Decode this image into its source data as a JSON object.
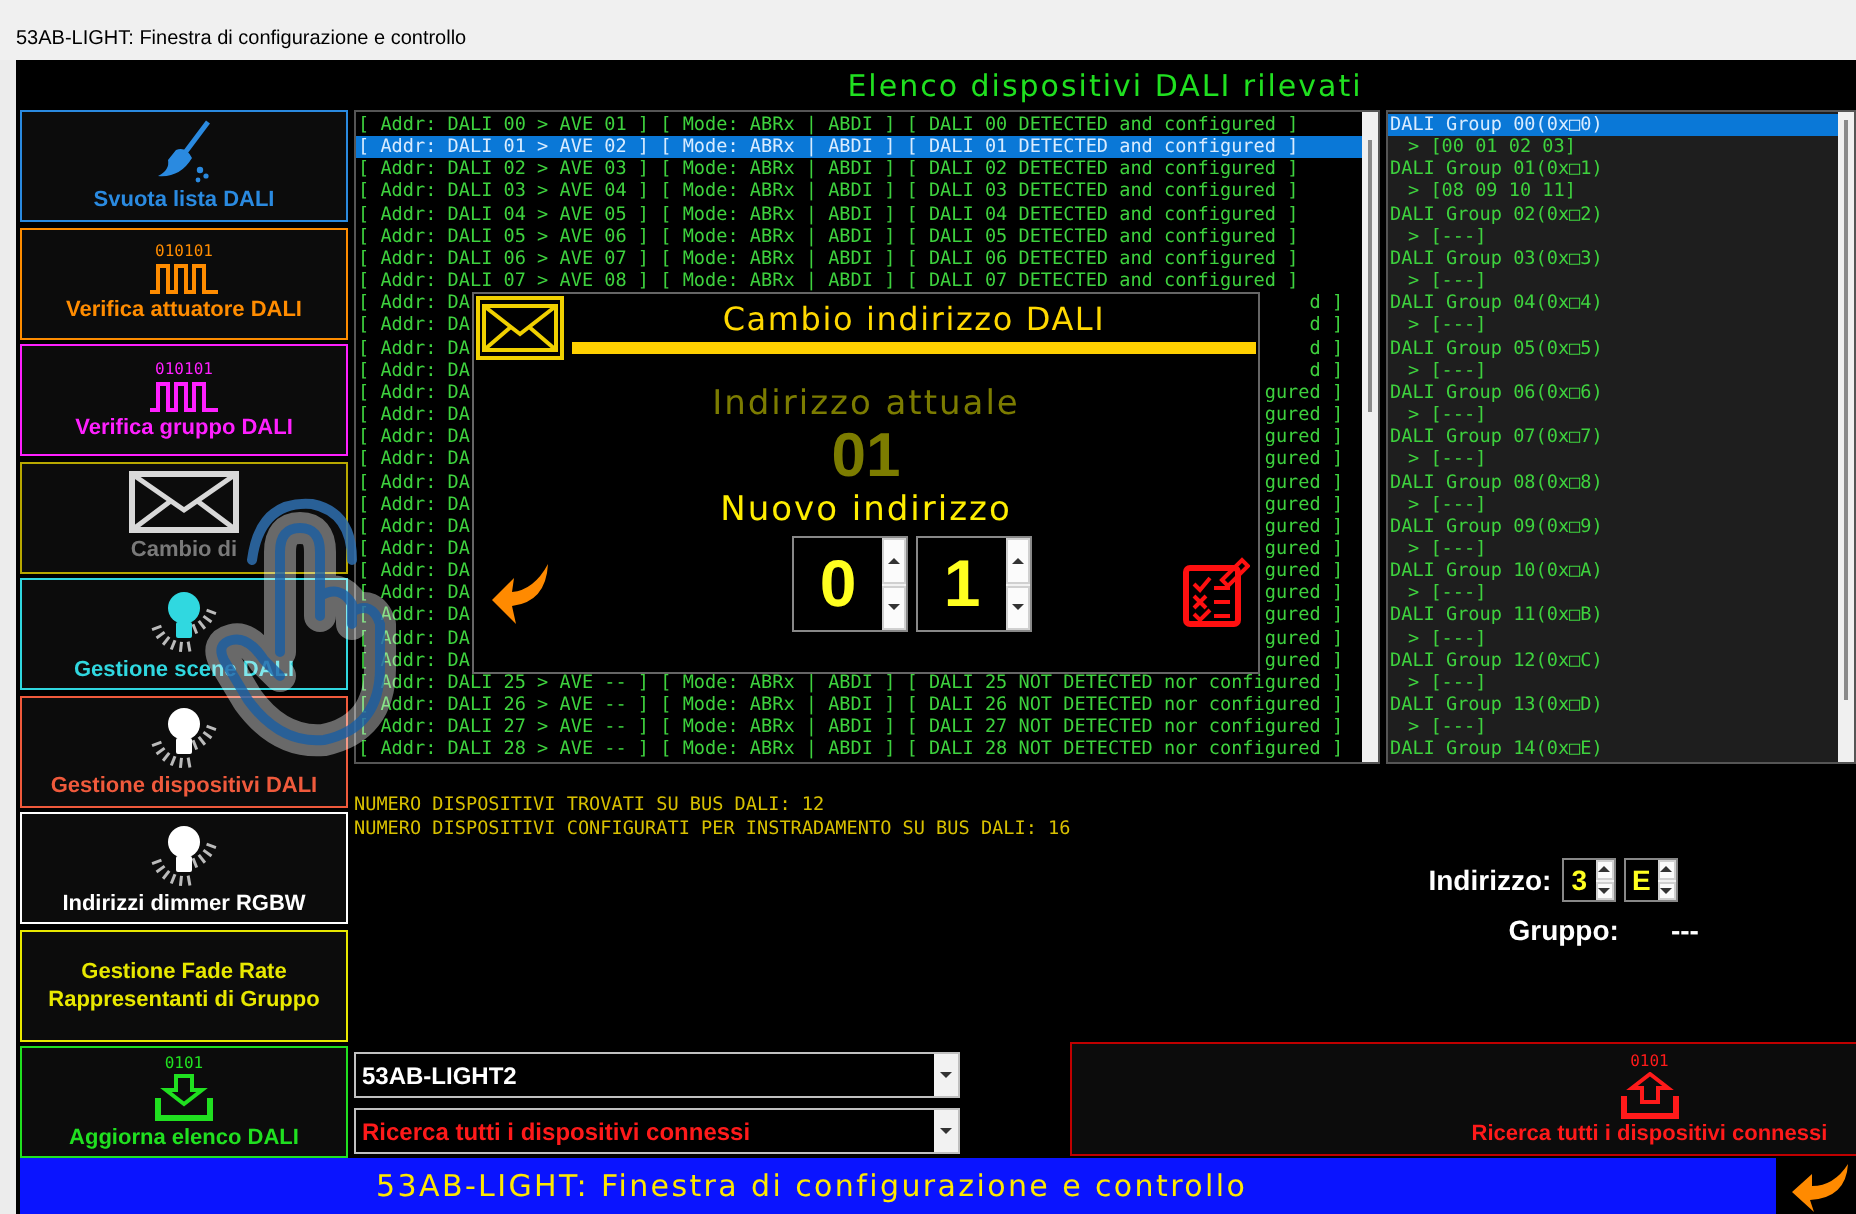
{
  "window": {
    "title": "53AB-LIGHT: Finestra di configurazione e controllo"
  },
  "heading": "Elenco dispositivi DALI rilevati",
  "sidebar": {
    "buttons": [
      {
        "label": "Svuota lista DALI",
        "kind": "broom",
        "color": "#2a8ae0"
      },
      {
        "label": "Verifica attuatore DALI",
        "kind": "pulse",
        "icon_text": "010101",
        "color": "#ff8c00"
      },
      {
        "label": "Verifica gruppo DALI",
        "kind": "pulse",
        "icon_text": "010101",
        "color": "#ff20ff"
      },
      {
        "label": "Cambio di",
        "kind": "envelope",
        "color": "#b8a800"
      },
      {
        "label": "Gestione scene DALI",
        "kind": "bulb",
        "color": "#30d8e0"
      },
      {
        "label": "Gestione dispositivi DALI",
        "kind": "lamp",
        "color": "#f05a3c"
      },
      {
        "label": "Indirizzi dimmer RGBW",
        "kind": "lamp",
        "color": "#ffffff"
      },
      {
        "label": "Gestione Fade Rate\nRappresentanti di Gruppo",
        "kind": "text",
        "color": "#e8e800"
      },
      {
        "label": "Aggiorna elenco DALI",
        "kind": "download",
        "icon_text": "0101",
        "color": "#20e020"
      }
    ]
  },
  "device_log": {
    "rows": [
      {
        "kind": "full",
        "text": "[ Addr: DALI 00 > AVE 01 ] [ Mode: ABRx | ABDI ] [ DALI 00 DETECTED and configured ]",
        "selected": false
      },
      {
        "kind": "full",
        "text": "[ Addr: DALI 01 > AVE 02 ] [ Mode: ABRx | ABDI ] [ DALI 01 DETECTED and configured ]",
        "selected": true
      },
      {
        "kind": "full",
        "text": "[ Addr: DALI 02 > AVE 03 ] [ Mode: ABRx | ABDI ] [ DALI 02 DETECTED and configured ]",
        "selected": false
      },
      {
        "kind": "full",
        "text": "[ Addr: DALI 03 > AVE 04 ] [ Mode: ABRx | ABDI ] [ DALI 03 DETECTED and configured ]",
        "selected": false
      },
      {
        "kind": "full",
        "text": "[ Addr: DALI 04 > AVE 05 ] [ Mode: ABRx | ABDI ] [ DALI 04 DETECTED and configured ]",
        "selected": false
      },
      {
        "kind": "full",
        "text": "[ Addr: DALI 05 > AVE 06 ] [ Mode: ABRx | ABDI ] [ DALI 05 DETECTED and configured ]",
        "selected": false
      },
      {
        "kind": "full",
        "text": "[ Addr: DALI 06 > AVE 07 ] [ Mode: ABRx | ABDI ] [ DALI 06 DETECTED and configured ]",
        "selected": false
      },
      {
        "kind": "full",
        "text": "[ Addr: DALI 07 > AVE 08 ] [ Mode: ABRx | ABDI ] [ DALI 07 DETECTED and configured ]",
        "selected": false
      },
      {
        "kind": "split",
        "left": "[ Addr: DA",
        "right": "d ]",
        "selected": false
      },
      {
        "kind": "split",
        "left": "[ Addr: DA",
        "right": "d ]",
        "selected": false
      },
      {
        "kind": "split",
        "left": "[ Addr: DA",
        "right": "d ]",
        "selected": false
      },
      {
        "kind": "split",
        "left": "[ Addr: DA",
        "right": "d ]",
        "selected": false
      },
      {
        "kind": "split",
        "left": "[ Addr: DA",
        "right": "gured ]",
        "selected": false
      },
      {
        "kind": "split",
        "left": "[ Addr: DA",
        "right": "gured ]",
        "selected": false
      },
      {
        "kind": "split",
        "left": "[ Addr: DA",
        "right": "gured ]",
        "selected": false
      },
      {
        "kind": "split",
        "left": "[ Addr: DA",
        "right": "gured ]",
        "selected": false
      },
      {
        "kind": "split",
        "left": "[ Addr: DA",
        "right": "gured ]",
        "selected": false
      },
      {
        "kind": "split",
        "left": "[ Addr: DA",
        "right": "gured ]",
        "selected": false
      },
      {
        "kind": "split",
        "left": "[ Addr: DA",
        "right": "gured ]",
        "selected": false
      },
      {
        "kind": "split",
        "left": "[ Addr: DA",
        "right": "gured ]",
        "selected": false
      },
      {
        "kind": "split",
        "left": "[ Addr: DA",
        "right": "gured ]",
        "selected": false
      },
      {
        "kind": "split",
        "left": "[ Addr: DA",
        "right": "gured ]",
        "selected": false
      },
      {
        "kind": "split",
        "left": "[ Addr: DA",
        "right": "gured ]",
        "selected": false
      },
      {
        "kind": "split",
        "left": "[ Addr: DA",
        "right": "gured ]",
        "selected": false
      },
      {
        "kind": "split",
        "left": "[ Addr: DA",
        "right": "gured ]",
        "selected": false
      },
      {
        "kind": "full",
        "text": "[ Addr: DALI 25 > AVE -- ] [ Mode: ABRx | ABDI ] [ DALI 25 NOT DETECTED nor configured ]",
        "selected": false
      },
      {
        "kind": "full",
        "text": "[ Addr: DALI 26 > AVE -- ] [ Mode: ABRx | ABDI ] [ DALI 26 NOT DETECTED nor configured ]",
        "selected": false
      },
      {
        "kind": "full",
        "text": "[ Addr: DALI 27 > AVE -- ] [ Mode: ABRx | ABDI ] [ DALI 27 NOT DETECTED nor configured ]",
        "selected": false
      },
      {
        "kind": "full",
        "text": "[ Addr: DALI 28 > AVE -- ] [ Mode: ABRx | ABDI ] [ DALI 28 NOT DETECTED nor configured ]",
        "selected": false
      }
    ]
  },
  "groups": [
    {
      "label": "DALI Group 00(0x□0)",
      "members": "> [00 01 02 03]",
      "selected": true
    },
    {
      "label": "DALI Group 01(0x□1)",
      "members": "> [08 09 10 11]",
      "selected": false
    },
    {
      "label": "DALI Group 02(0x□2)",
      "members": "> [---]",
      "selected": false
    },
    {
      "label": "DALI Group 03(0x□3)",
      "members": "> [---]",
      "selected": false
    },
    {
      "label": "DALI Group 04(0x□4)",
      "members": "> [---]",
      "selected": false
    },
    {
      "label": "DALI Group 05(0x□5)",
      "members": "> [---]",
      "selected": false
    },
    {
      "label": "DALI Group 06(0x□6)",
      "members": "> [---]",
      "selected": false
    },
    {
      "label": "DALI Group 07(0x□7)",
      "members": "> [---]",
      "selected": false
    },
    {
      "label": "DALI Group 08(0x□8)",
      "members": "> [---]",
      "selected": false
    },
    {
      "label": "DALI Group 09(0x□9)",
      "members": "> [---]",
      "selected": false
    },
    {
      "label": "DALI Group 10(0x□A)",
      "members": "> [---]",
      "selected": false
    },
    {
      "label": "DALI Group 11(0x□B)",
      "members": "> [---]",
      "selected": false
    },
    {
      "label": "DALI Group 12(0x□C)",
      "members": "> [---]",
      "selected": false
    },
    {
      "label": "DALI Group 13(0x□D)",
      "members": "> [---]",
      "selected": false
    },
    {
      "label": "DALI Group 14(0x□E)",
      "selected": false
    }
  ],
  "messages": [
    "NUMERO DISPOSITIVI TROVATI SU BUS DALI: 12",
    "NUMERO DISPOSITIVI CONFIGURATI PER INSTRADAMENTO SU BUS DALI: 16"
  ],
  "address": {
    "label": "Indirizzo:",
    "digits": [
      "3",
      "E"
    ]
  },
  "group": {
    "label": "Gruppo:",
    "value": "---"
  },
  "dropdowns": [
    {
      "value": "53AB-LIGHT2",
      "kind": "normal"
    },
    {
      "value": "Ricerca tutti i dispositivi connessi",
      "kind": "alert"
    }
  ],
  "search_button": {
    "label": "Ricerca tutti i dispositivi connessi",
    "icon_text": "0101"
  },
  "status_bar": {
    "text": "53AB-LIGHT: Finestra di configurazione e controllo"
  },
  "dialog": {
    "title": "Cambio indirizzo DALI",
    "current_label": "Indirizzo attuale",
    "current_value": "01",
    "new_label": "Nuovo indirizzo",
    "new_digits": [
      "0",
      "1"
    ]
  }
}
